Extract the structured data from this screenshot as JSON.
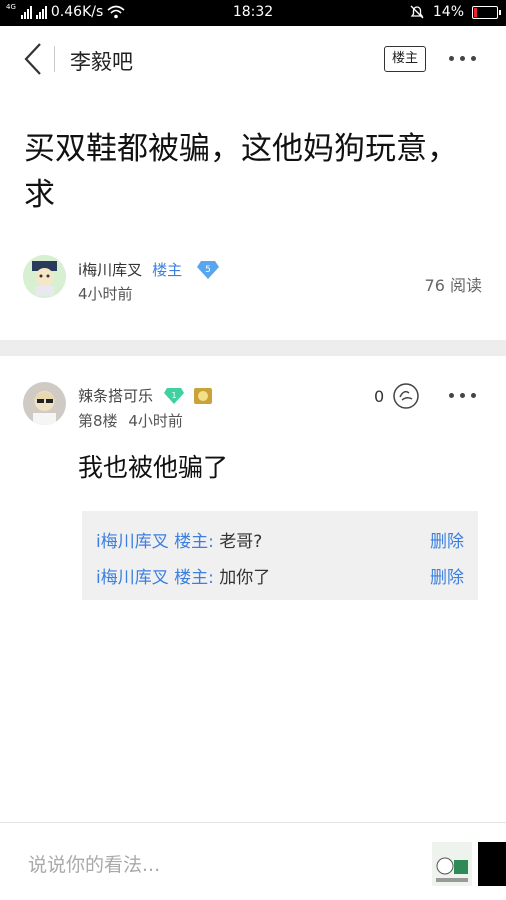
{
  "status_bar": {
    "network": "4G",
    "speed": "0.46K/s",
    "time": "18:32",
    "battery": "14%",
    "battery_level": 0.14
  },
  "nav": {
    "forum_name": "李毅吧",
    "owner_only_label": "楼主"
  },
  "post": {
    "title": "买双鞋都被骗，这他妈狗玩意，求",
    "author": "i梅川库叉",
    "owner_tag": "楼主",
    "level": "5",
    "time": "4小时前",
    "reads": "76 阅读"
  },
  "reply": {
    "author": "辣条搭可乐",
    "level": "1",
    "floor": "第8楼",
    "time": "4小时前",
    "like_count": "0",
    "text": "我也被他骗了",
    "sub_replies": [
      {
        "who": "i梅川库叉 楼主:",
        "text": "老哥?",
        "delete": "删除"
      },
      {
        "who": "i梅川库叉 楼主:",
        "text": "加你了",
        "delete": "删除"
      }
    ]
  },
  "bottom": {
    "placeholder": "说说你的看法..."
  },
  "colors": {
    "accent": "#3c7fe0",
    "divider": "#ededed"
  }
}
